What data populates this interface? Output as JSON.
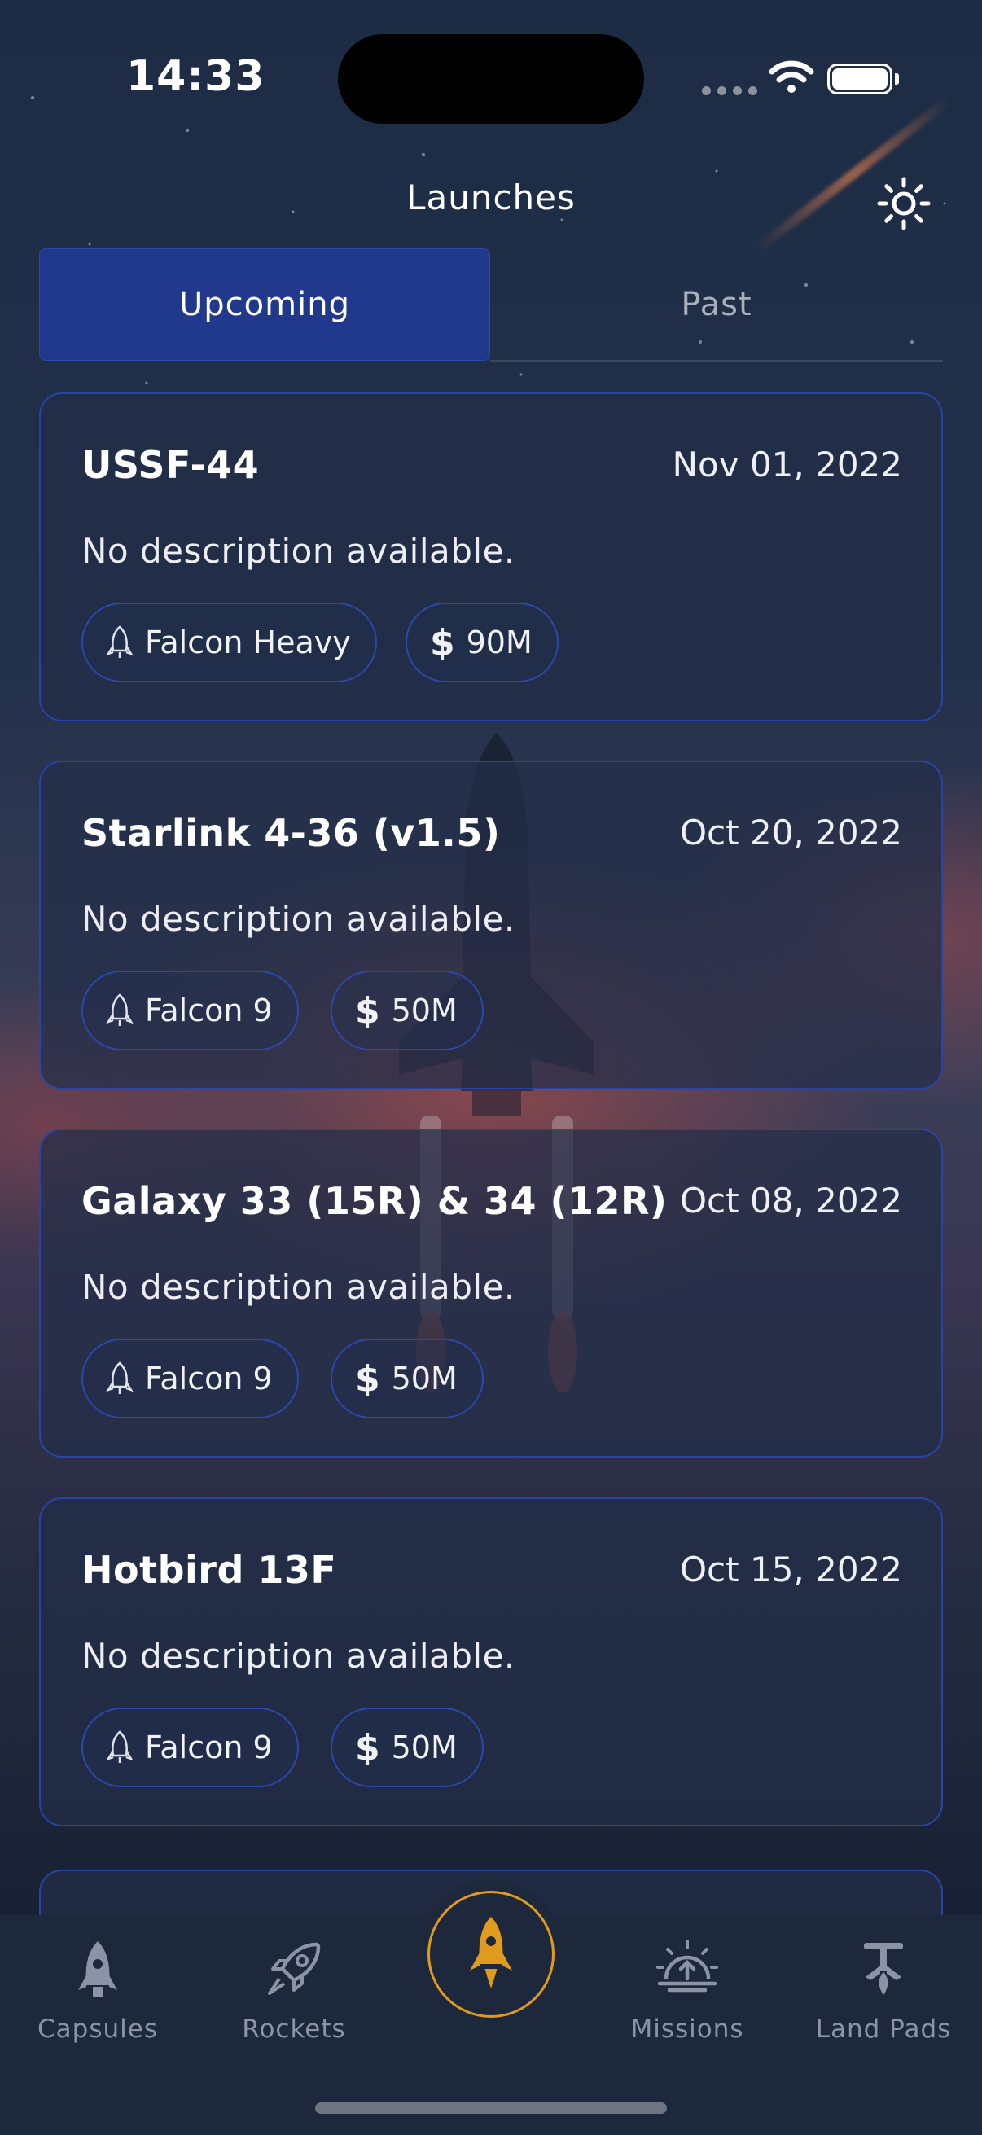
{
  "status_bar": {
    "time": "14:33"
  },
  "header": {
    "title": "Launches"
  },
  "tabs": [
    {
      "label": "Upcoming",
      "active": true
    },
    {
      "label": "Past",
      "active": false
    }
  ],
  "launches": [
    {
      "name": "USSF-44",
      "date": "Nov 01, 2022",
      "description": "No description available.",
      "rocket": "Falcon Heavy",
      "cost": "90M"
    },
    {
      "name": "Starlink 4-36 (v1.5)",
      "date": "Oct 20, 2022",
      "description": "No description available.",
      "rocket": "Falcon 9",
      "cost": "50M"
    },
    {
      "name": "Galaxy 33 (15R) & 34 (12R)",
      "date": "Oct 08, 2022",
      "description": "No description available.",
      "rocket": "Falcon 9",
      "cost": "50M"
    },
    {
      "name": "Hotbird 13F",
      "date": "Oct 15, 2022",
      "description": "No description available.",
      "rocket": "Falcon 9",
      "cost": "50M"
    }
  ],
  "bottom_nav": {
    "items": [
      {
        "label": "Capsules",
        "icon": "capsule-icon"
      },
      {
        "label": "Rockets",
        "icon": "rocket-icon"
      },
      {
        "label": "",
        "icon": "launch-rocket-icon",
        "active": true
      },
      {
        "label": "Missions",
        "icon": "mission-icon"
      },
      {
        "label": "Land Pads",
        "icon": "landpad-icon"
      }
    ]
  },
  "colors": {
    "accent_blue": "#21398c",
    "card_border": "#2a44a6",
    "active_orange": "#e09a1e",
    "nav_inactive": "#8b93a5"
  }
}
